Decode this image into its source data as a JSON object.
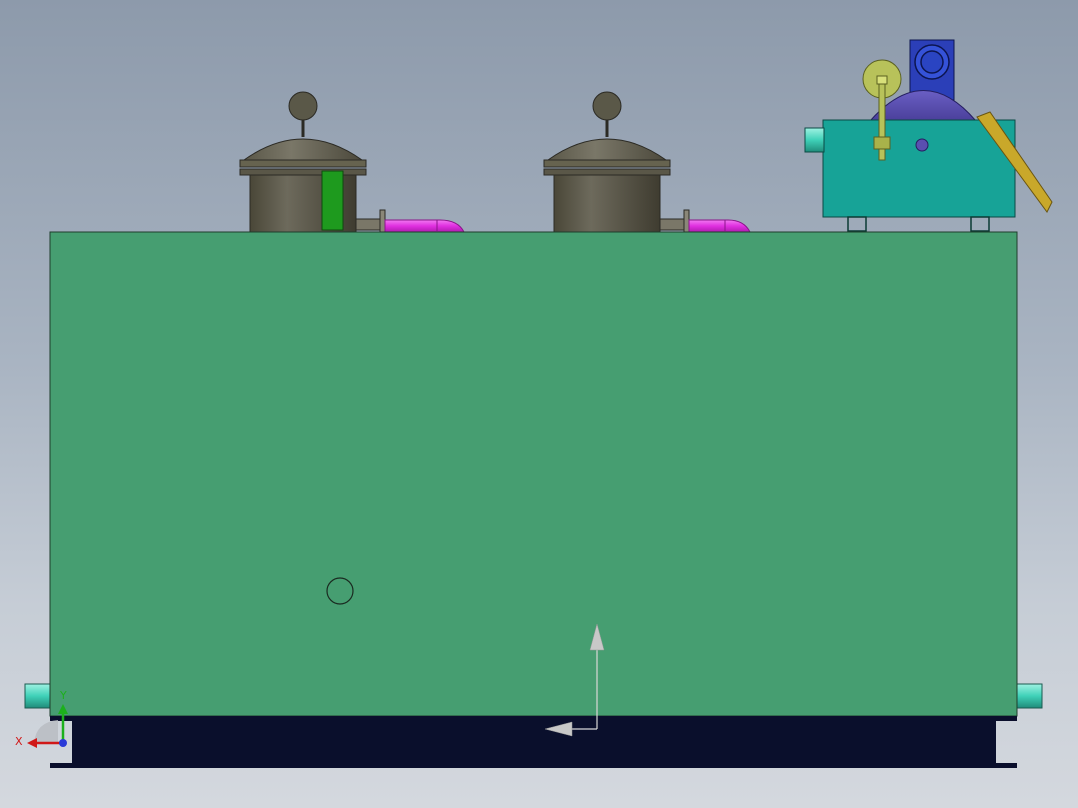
{
  "triad": {
    "x_label": "X",
    "y_label": "Y"
  },
  "colors": {
    "tank_body": "#469e71",
    "base_skid": "#0a0f2c",
    "filter_housing": "#5e5a4c",
    "pipe": "#e040e0",
    "pump_body": "#17a397",
    "motor": "#5a4fb0",
    "level_indicator": "#1e9a1e",
    "valve_handwheel": "#b8c25a",
    "connection_port": "#3fd1b8"
  },
  "icons": {
    "triad": "view-orientation-triad-icon",
    "origin_marker": "origin-arrows-icon",
    "hole_marker": "circle-hole-icon"
  }
}
